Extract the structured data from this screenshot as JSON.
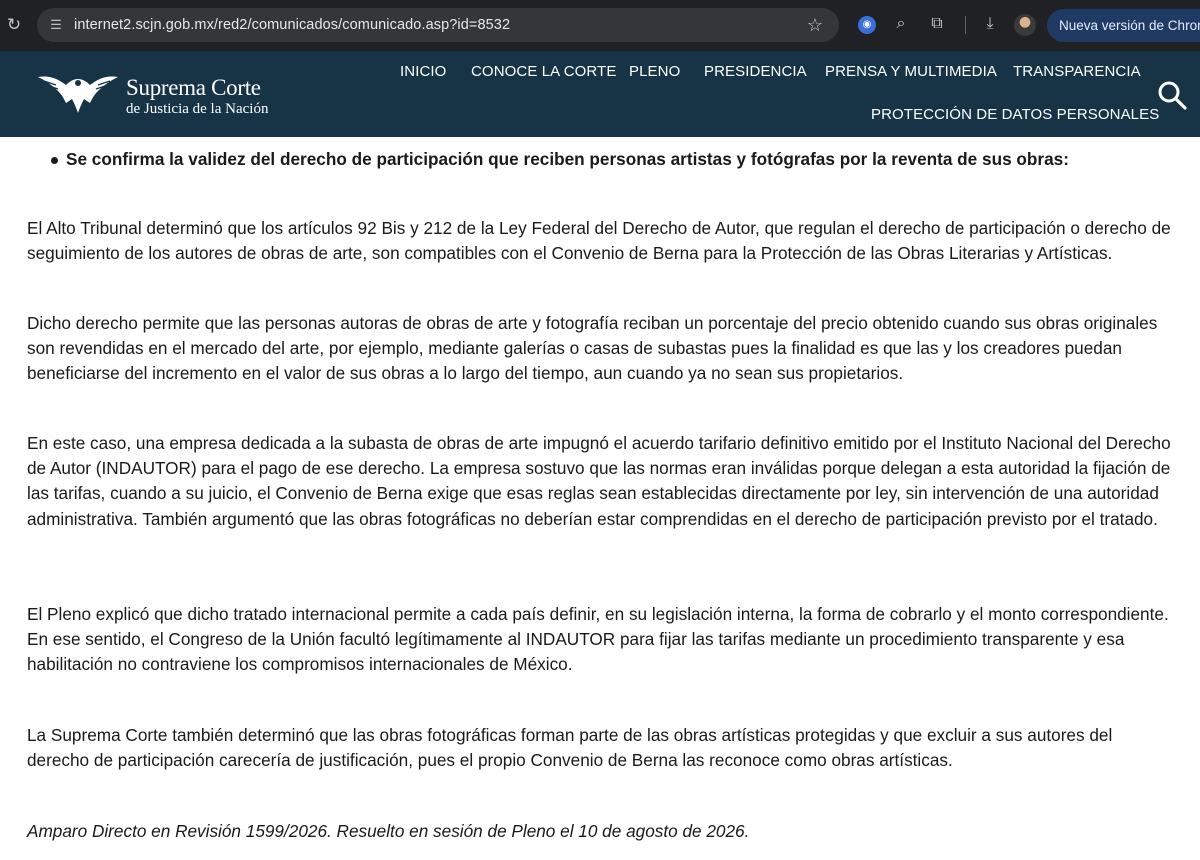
{
  "browser": {
    "url": "internet2.scjn.gob.mx/red2/comunicados/comunicado.asp?id=8532",
    "update_label": "Nueva versión de Chrome"
  },
  "site": {
    "logo_title": "Suprema Corte",
    "logo_subtitle": "de Justicia de la Nación",
    "nav": [
      "INICIO",
      "CONOCE LA CORTE",
      "PLENO",
      "PRESIDENCIA",
      "PRENSA Y MULTIMEDIA",
      "TRANSPARENCIA",
      "PROTECCIÓN DE DATOS PERSONALES"
    ]
  },
  "article": {
    "bullet": "Se confirma la validez del derecho de participación que reciben personas artistas y fotógrafas por la reventa de sus obras:",
    "paragraphs": [
      "El Alto Tribunal determinó que los artículos 92 Bis y 212 de la Ley Federal del Derecho de Autor, que regulan el derecho de participación o derecho de seguimiento de los autores de obras de arte, son compatibles con el Convenio de Berna para la Protección de las Obras Literarias y Artísticas.",
      "Dicho derecho permite que las personas autoras de obras de arte y fotografía reciban un porcentaje del precio obtenido cuando sus obras originales son revendidas en el mercado del arte, por ejemplo, mediante galerías o casas de subastas pues la finalidad es que las y los creadores puedan beneficiarse del incremento en el valor de sus obras a lo largo del tiempo, aun cuando ya no sean sus propietarios.",
      "En este caso, una empresa dedicada a la subasta de obras de arte impugnó el acuerdo tarifario definitivo emitido por el Instituto Nacional del Derecho de Autor (INDAUTOR) para el pago de ese derecho. La empresa sostuvo que las normas eran inválidas porque delegan a esta autoridad la fijación de las tarifas, cuando a su juicio, el Convenio de Berna exige que esas reglas sean establecidas directamente por ley, sin intervención de una autoridad administrativa. También argumentó que las obras fotográficas no deberían estar comprendidas en el derecho de participación previsto por el tratado.",
      "El Pleno explicó que dicho tratado internacional permite a cada país definir, en su legislación interna, la forma de cobrarlo y el monto correspondiente. En ese sentido, el Congreso de la Unión facultó legítimamente al INDAUTOR para fijar las tarifas mediante un procedimiento transparente y esa habilitación no contraviene los compromisos internacionales de México.",
      "La Suprema Corte también determinó que las obras fotográficas forman parte de las obras artísticas protegidas y que excluir a sus autores del derecho de participación carecería de justificación, pues el propio Convenio de Berna las reconoce como obras artísticas."
    ],
    "footer_note": "Amparo Directo en Revisión 1599/2026. Resuelto en sesión de Pleno el 10 de agosto de 2026."
  }
}
